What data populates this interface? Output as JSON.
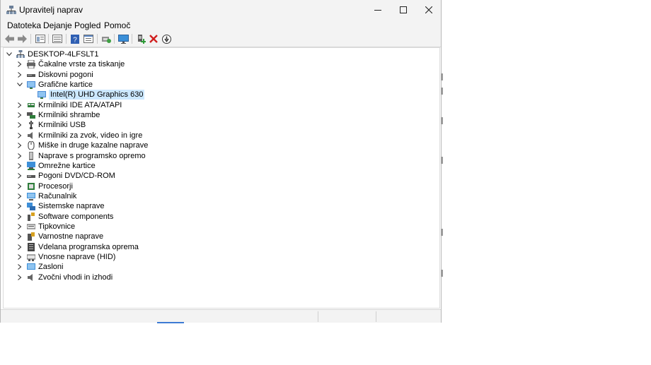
{
  "window": {
    "title": "Upravitelj naprav",
    "buttons": {
      "minimize": "—",
      "maximize": "☐",
      "close": "✕"
    }
  },
  "menu": [
    "Datoteka",
    "Dejanje",
    "Pogled",
    "Pomoč"
  ],
  "toolbar": {
    "icons": [
      "back-icon",
      "forward-icon",
      "properties-view-icon",
      "list-view-icon",
      "help-icon",
      "driver-details-icon",
      "scan-hardware-icon",
      "monitor-icon",
      "add-driver-icon",
      "uninstall-icon",
      "disable-device-icon"
    ]
  },
  "tree": {
    "root": "DESKTOP-4LFSLT1",
    "items": [
      {
        "label": "Čakalne vrste za tiskanje",
        "icon": "print-queue-icon"
      },
      {
        "label": "Diskovni pogoni",
        "icon": "disk-drive-icon"
      },
      {
        "label": "Grafične kartice",
        "icon": "display-adapter-icon",
        "expanded": true,
        "children": [
          {
            "label": "Intel(R) UHD Graphics 630",
            "icon": "graphics-card-icon",
            "selected": true
          }
        ]
      },
      {
        "label": "Krmilniki IDE ATA/ATAPI",
        "icon": "ide-controller-icon"
      },
      {
        "label": "Krmilniki shrambe",
        "icon": "storage-controller-icon"
      },
      {
        "label": "Krmilniki USB",
        "icon": "usb-icon"
      },
      {
        "label": "Krmilniki za zvok, video in igre",
        "icon": "audio-icon"
      },
      {
        "label": "Miške in druge kazalne naprave",
        "icon": "mouse-icon"
      },
      {
        "label": "Naprave s programsko opremo",
        "icon": "software-device-icon"
      },
      {
        "label": "Omrežne kartice",
        "icon": "network-adapter-icon"
      },
      {
        "label": "Pogoni DVD/CD-ROM",
        "icon": "dvd-drive-icon"
      },
      {
        "label": "Procesorji",
        "icon": "processor-icon"
      },
      {
        "label": "Računalnik",
        "icon": "computer-icon"
      },
      {
        "label": "Sistemske naprave",
        "icon": "system-device-icon"
      },
      {
        "label": "Software components",
        "icon": "software-component-icon"
      },
      {
        "label": "Tipkovnice",
        "icon": "keyboard-icon"
      },
      {
        "label": "Varnostne naprave",
        "icon": "security-device-icon"
      },
      {
        "label": "Vdelana programska oprema",
        "icon": "firmware-icon"
      },
      {
        "label": "Vnosne naprave (HID)",
        "icon": "hid-icon"
      },
      {
        "label": "Zasloni",
        "icon": "monitor-icon"
      },
      {
        "label": "Zvočni vhodi in izhodi",
        "icon": "speaker-icon"
      }
    ]
  },
  "colors": {
    "selection": "#cce8ff",
    "chrome": "#f3f3f3",
    "accent": "#3d7bd4"
  }
}
